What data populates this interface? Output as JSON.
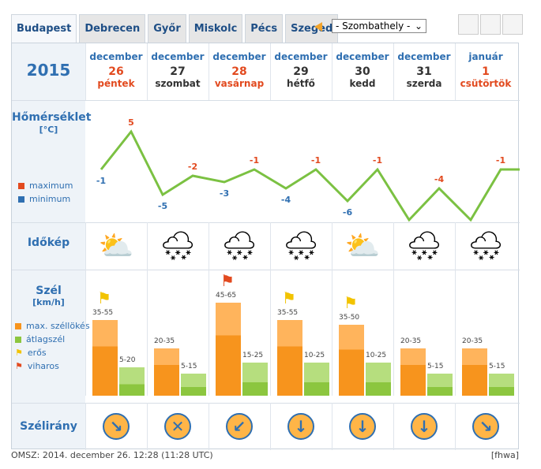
{
  "tabs": [
    "Budapest",
    "Debrecen",
    "Győr",
    "Miskolc",
    "Pécs",
    "Szeged"
  ],
  "city_select": "- Szombathely -",
  "year": "2015",
  "days": [
    {
      "month": "december",
      "date": "26",
      "weekday": "péntek",
      "color": "red",
      "max": 5,
      "min": -1,
      "icon": "⛅",
      "wind_max": "35-55",
      "wind_avg": "5-20",
      "dir": "↘",
      "flag": "⚑",
      "flag_color": "#f2c300"
    },
    {
      "month": "december",
      "date": "27",
      "weekday": "szombat",
      "color": "dark",
      "max": -2,
      "min": -5,
      "icon": "🌨",
      "wind_max": "20-35",
      "wind_avg": "5-15",
      "dir": "✕",
      "flag": "",
      "flag_color": ""
    },
    {
      "month": "december",
      "date": "28",
      "weekday": "vasárnap",
      "color": "red",
      "max": -1,
      "min": -3,
      "icon": "🌨",
      "wind_max": "45-65",
      "wind_avg": "15-25",
      "dir": "↙",
      "flag": "⚑",
      "flag_color": "#e24a1f"
    },
    {
      "month": "december",
      "date": "29",
      "weekday": "hétfő",
      "color": "dark",
      "max": -1,
      "min": -4,
      "icon": "🌨",
      "wind_max": "35-55",
      "wind_avg": "10-25",
      "dir": "↓",
      "flag": "⚑",
      "flag_color": "#f2c300"
    },
    {
      "month": "december",
      "date": "30",
      "weekday": "kedd",
      "color": "dark",
      "max": -1,
      "min": -6,
      "icon": "⛅",
      "wind_max": "35-50",
      "wind_avg": "10-25",
      "dir": "↓",
      "flag": "⚑",
      "flag_color": "#f2c300"
    },
    {
      "month": "december",
      "date": "31",
      "weekday": "szerda",
      "color": "dark",
      "max": -4,
      "min": -9,
      "icon": "🌨",
      "wind_max": "20-35",
      "wind_avg": "5-15",
      "dir": "↓",
      "flag": "",
      "flag_color": ""
    },
    {
      "month": "január",
      "date": "1",
      "weekday": "csütörtök",
      "color": "red",
      "max": -1,
      "min": -9,
      "icon": "🌨",
      "wind_max": "20-35",
      "wind_avg": "5-15",
      "dir": "↘",
      "flag": "",
      "flag_color": ""
    }
  ],
  "labels": {
    "temp": "Hőmérséklet",
    "temp_unit": "[°C]",
    "legend_max": "maximum",
    "legend_min": "minimum",
    "idokep": "Időkép",
    "wind": "Szél",
    "wind_unit": "[km/h]",
    "legend_gust": "max. széllökés",
    "legend_avg": "átlagszél",
    "legend_strong": "erős",
    "legend_storm": "viharos",
    "direction": "Szélirány"
  },
  "footer": {
    "left": "OMSZ: 2014. december 26. 12:28 (11:28 UTC)",
    "right": "[fhwa]"
  }
}
